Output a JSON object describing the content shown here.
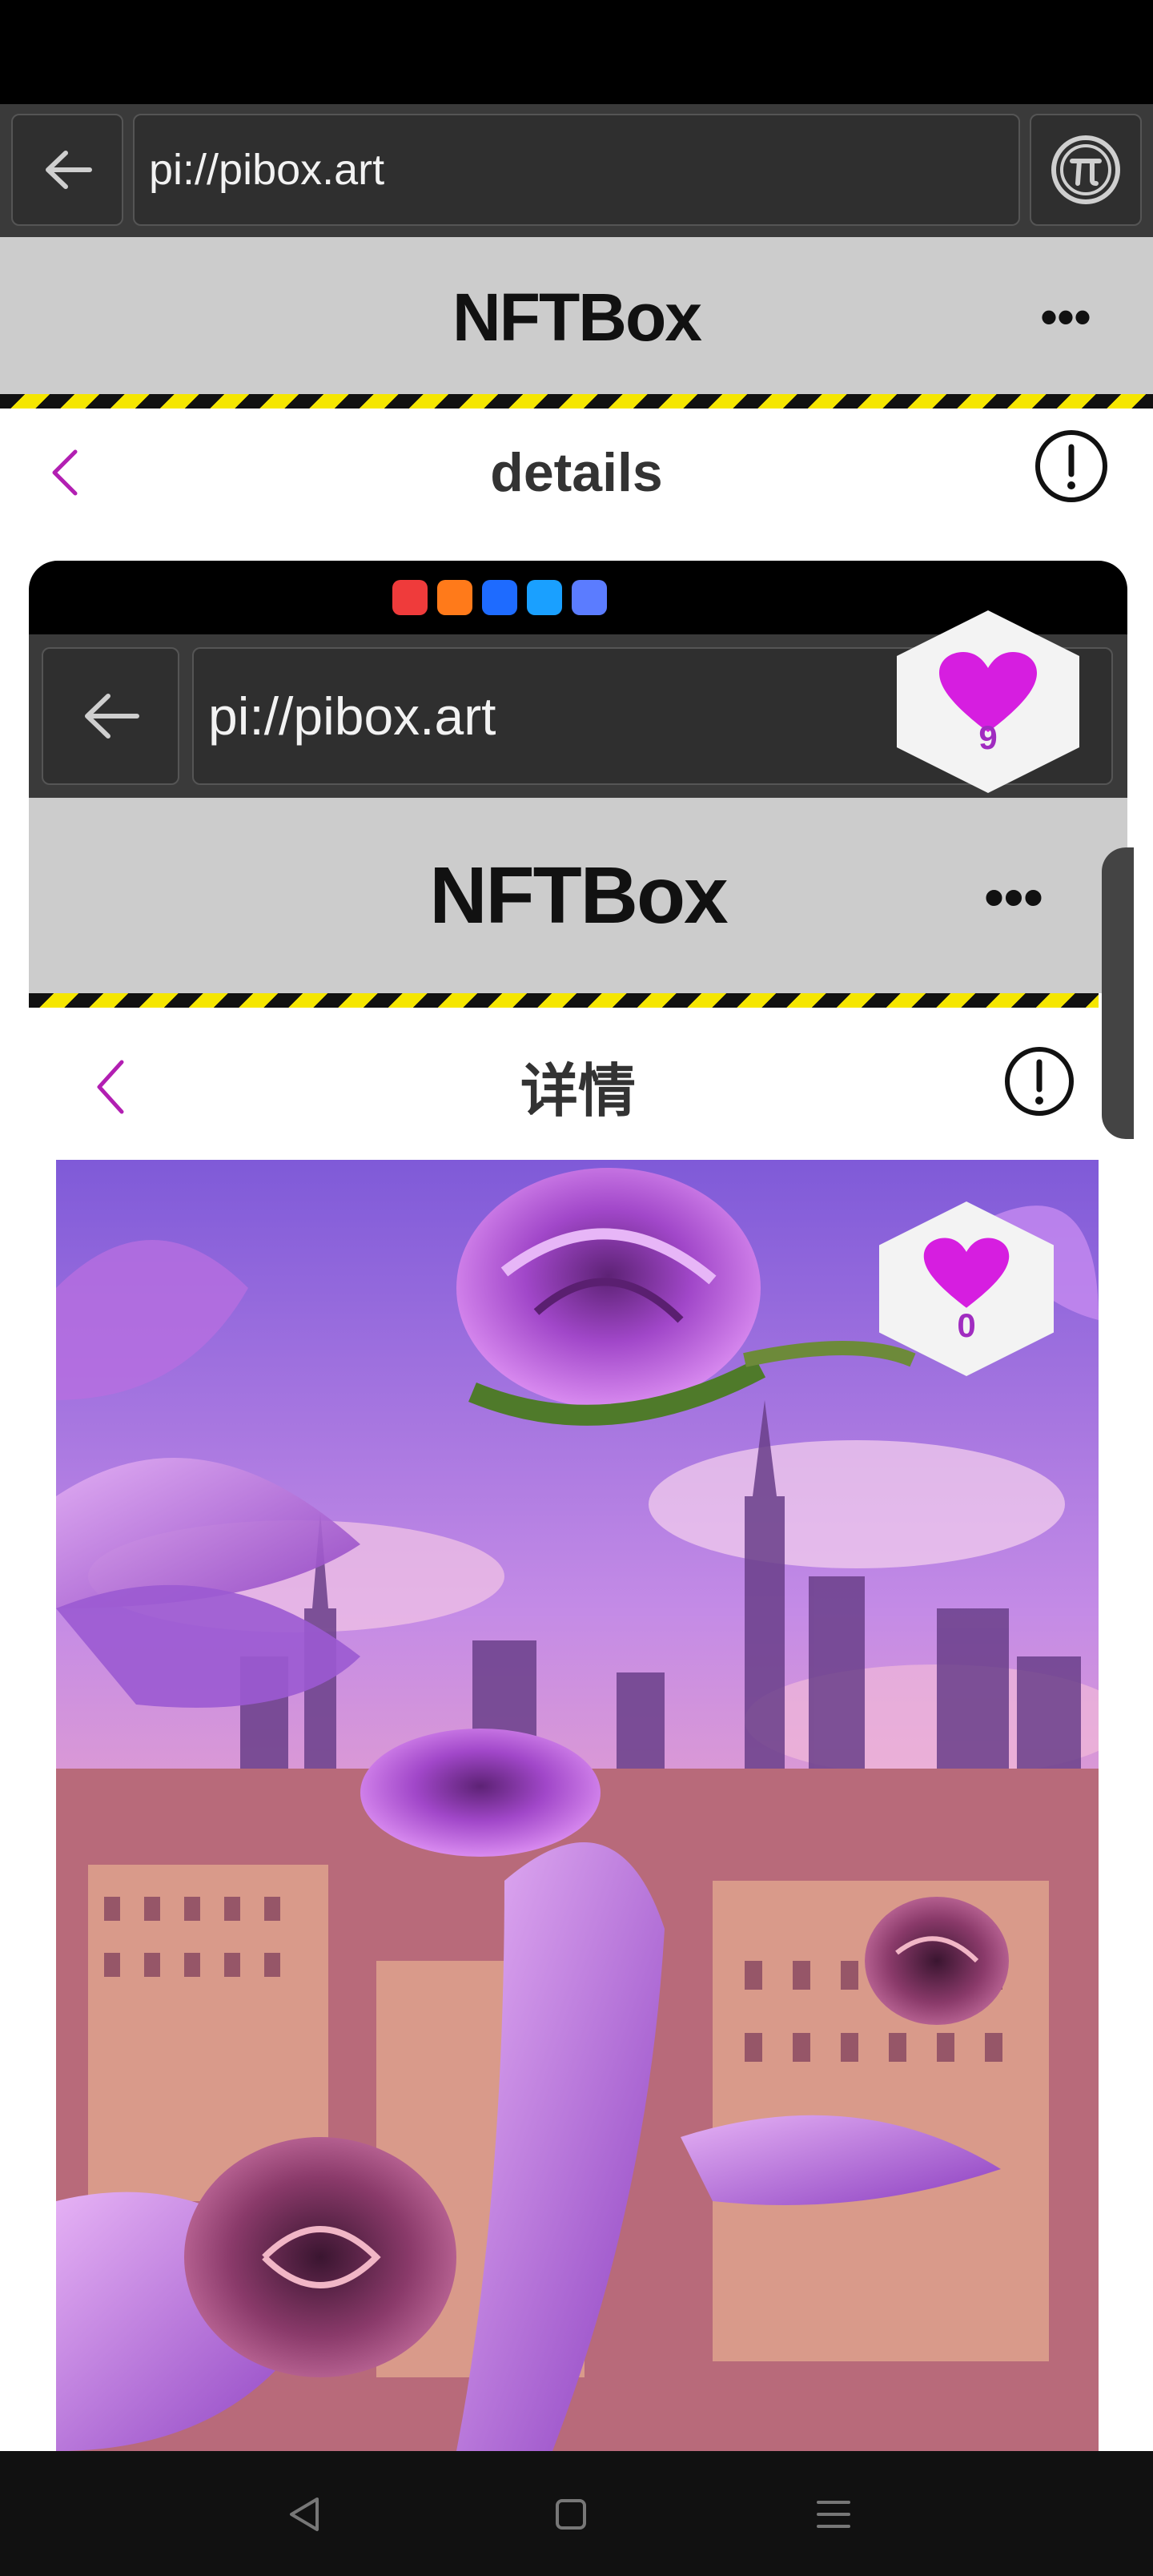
{
  "browser": {
    "url": "pi://pibox.art"
  },
  "app": {
    "title": "NFTBox",
    "more_label": "•••"
  },
  "details": {
    "title": "details"
  },
  "inner": {
    "url": "pi://pibox.art",
    "app_title": "NFTBox",
    "more_label": "•••",
    "details_title": "详情",
    "app_icon_colors": [
      "#ef3b3b",
      "#ff7a1a",
      "#1e6bff",
      "#1aa0ff",
      "#5b7cff"
    ]
  },
  "likes": {
    "outer_count": "9",
    "inner_count": "0"
  },
  "colors": {
    "accent": "#b21fb2",
    "heart": "#d61ee0",
    "stripe_yellow": "#f5e600"
  },
  "icons": [
    "back-arrow-icon",
    "pi-logo-icon",
    "more-icon",
    "chevron-left-icon",
    "info-icon",
    "heart-icon",
    "nav-back-icon",
    "nav-home-icon",
    "nav-menu-icon"
  ]
}
